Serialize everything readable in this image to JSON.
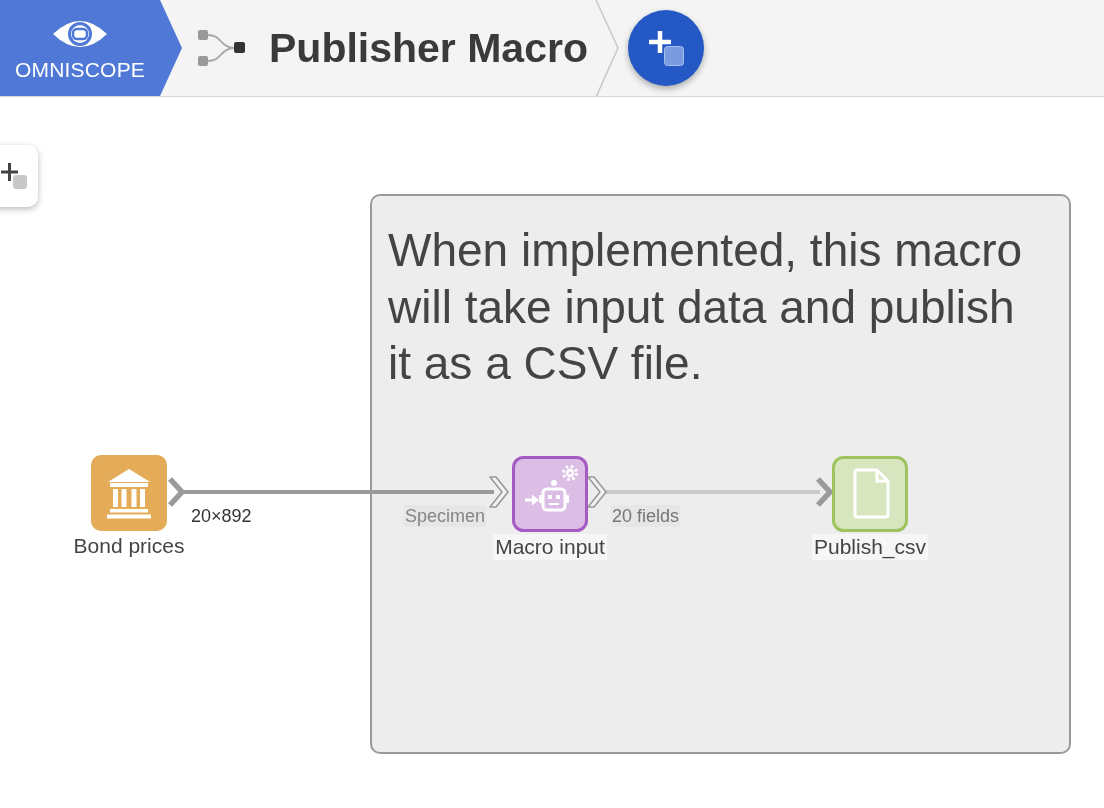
{
  "header": {
    "logo_text": "OMNISCOPE",
    "title": "Publisher Macro"
  },
  "canvas": {
    "group": {
      "text": "When implemented, this macro will take input data and publish it as a CSV file."
    },
    "nodes": [
      {
        "label": "Bond prices",
        "kind": "source"
      },
      {
        "label": "Macro input",
        "kind": "macro_input"
      },
      {
        "label": "Publish_csv",
        "kind": "publish"
      }
    ],
    "connections": [
      {
        "label": "20×892",
        "input_label": "Specimen"
      },
      {
        "label": "20 fields"
      }
    ]
  }
}
